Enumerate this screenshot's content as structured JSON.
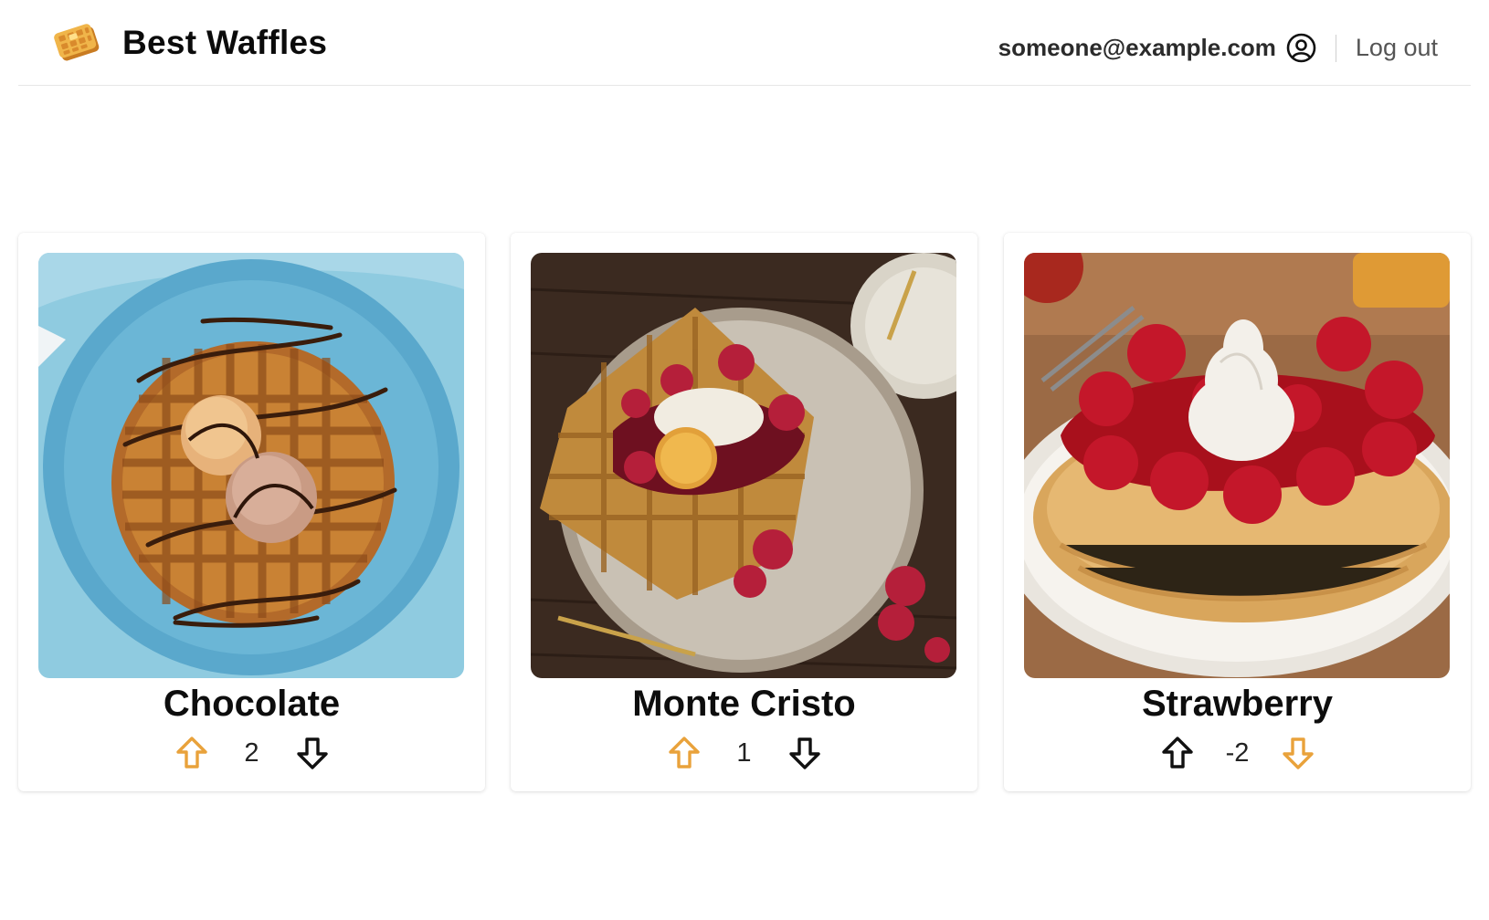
{
  "header": {
    "title": "Best Waffles",
    "logo_icon": "waffle-icon",
    "user_email": "someone@example.com",
    "user_icon": "user-circle-icon",
    "logout_label": "Log out"
  },
  "colors": {
    "accent_orange": "#E9A23B",
    "text_dark": "#111111",
    "muted": "#555555"
  },
  "waffles": [
    {
      "name": "Chocolate",
      "score": "2",
      "vote": "up"
    },
    {
      "name": "Monte Cristo",
      "score": "1",
      "vote": "up"
    },
    {
      "name": "Strawberry",
      "score": "-2",
      "vote": "down"
    }
  ]
}
